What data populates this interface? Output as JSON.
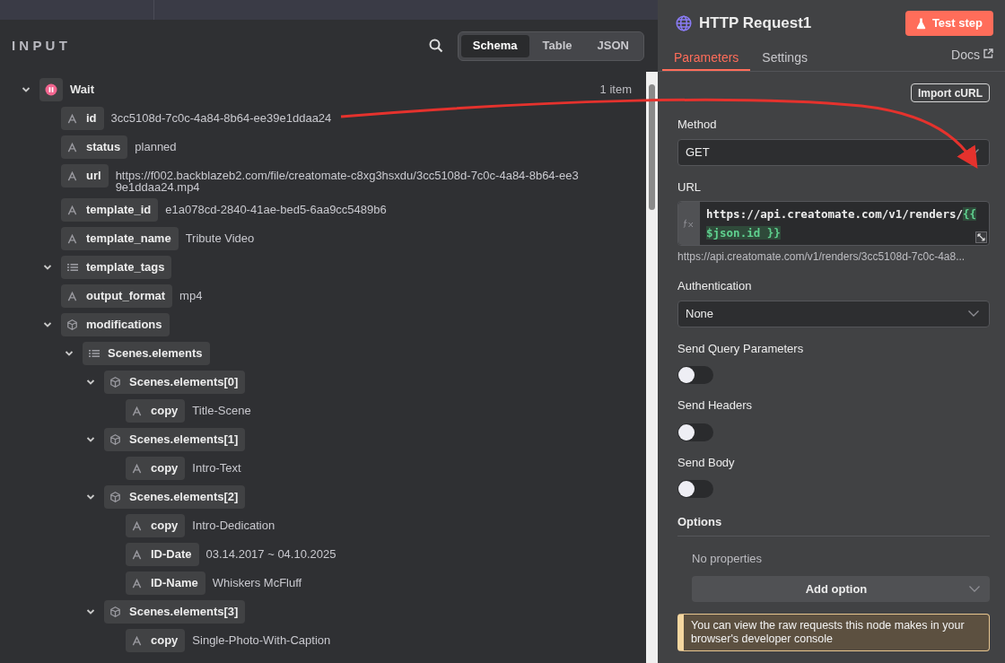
{
  "input_panel": {
    "title": "INPUT",
    "view_tabs": [
      {
        "label": "Schema",
        "selected": true
      },
      {
        "label": "Table",
        "selected": false
      },
      {
        "label": "JSON",
        "selected": false
      }
    ],
    "tree": [
      {
        "kind": "node",
        "key": "Wait",
        "count": "1 item",
        "expanded": true,
        "children": [
          {
            "kind": "string",
            "key": "id",
            "value": "3cc5108d-7c0c-4a84-8b64-ee39e1ddaa24"
          },
          {
            "kind": "string",
            "key": "status",
            "value": "planned"
          },
          {
            "kind": "string",
            "key": "url",
            "value": "https://f002.backblazeb2.com/file/creatomate-c8xg3hsxdu/3cc5108d-7c0c-4a84-8b64-ee39e1ddaa24.mp4"
          },
          {
            "kind": "string",
            "key": "template_id",
            "value": "e1a078cd-2840-41ae-bed5-6aa9cc5489b6"
          },
          {
            "kind": "string",
            "key": "template_name",
            "value": "Tribute Video"
          },
          {
            "kind": "array",
            "key": "template_tags",
            "expanded": true
          },
          {
            "kind": "string",
            "key": "output_format",
            "value": "mp4"
          },
          {
            "kind": "object",
            "key": "modifications",
            "expanded": true,
            "children": [
              {
                "kind": "array",
                "key": "Scenes.elements",
                "expanded": true,
                "children": [
                  {
                    "kind": "object",
                    "key": "Scenes.elements[0]",
                    "expanded": true,
                    "children": [
                      {
                        "kind": "string",
                        "key": "copy",
                        "value": "Title-Scene"
                      }
                    ]
                  },
                  {
                    "kind": "object",
                    "key": "Scenes.elements[1]",
                    "expanded": true,
                    "children": [
                      {
                        "kind": "string",
                        "key": "copy",
                        "value": "Intro-Text"
                      }
                    ]
                  },
                  {
                    "kind": "object",
                    "key": "Scenes.elements[2]",
                    "expanded": true,
                    "children": [
                      {
                        "kind": "string",
                        "key": "copy",
                        "value": "Intro-Dedication"
                      },
                      {
                        "kind": "string",
                        "key": "ID-Date",
                        "value": "03.14.2017 ~ 04.10.2025"
                      },
                      {
                        "kind": "string",
                        "key": "ID-Name",
                        "value": "Whiskers McFluff"
                      }
                    ]
                  },
                  {
                    "kind": "object",
                    "key": "Scenes.elements[3]",
                    "expanded": true,
                    "children": [
                      {
                        "kind": "string",
                        "key": "copy",
                        "value": "Single-Photo-With-Caption"
                      }
                    ]
                  }
                ]
              }
            ]
          }
        ]
      }
    ]
  },
  "node_panel": {
    "title": "HTTP Request1",
    "test_button": "Test step",
    "tabs": [
      {
        "label": "Parameters",
        "selected": true
      },
      {
        "label": "Settings",
        "selected": false
      }
    ],
    "docs_link": "Docs",
    "import_button": "Import cURL",
    "fields": [
      {
        "kind": "select",
        "label": "Method",
        "value": "GET"
      },
      {
        "kind": "expression",
        "label": "URL",
        "text": "https://api.creatomate.com/v1/renders/",
        "expression": "{{ $json.id }}",
        "resolved": "https://api.creatomate.com/v1/renders/3cc5108d-7c0c-4a8..."
      },
      {
        "kind": "select",
        "label": "Authentication",
        "value": "None"
      },
      {
        "kind": "toggle",
        "label": "Send Query Parameters",
        "on": false
      },
      {
        "kind": "toggle",
        "label": "Send Headers",
        "on": false
      },
      {
        "kind": "toggle",
        "label": "Send Body",
        "on": false
      }
    ],
    "options": {
      "label": "Options",
      "empty_text": "No properties",
      "add_button": "Add option"
    },
    "notice": "You can view the raw requests this node makes in your browser's developer console"
  }
}
